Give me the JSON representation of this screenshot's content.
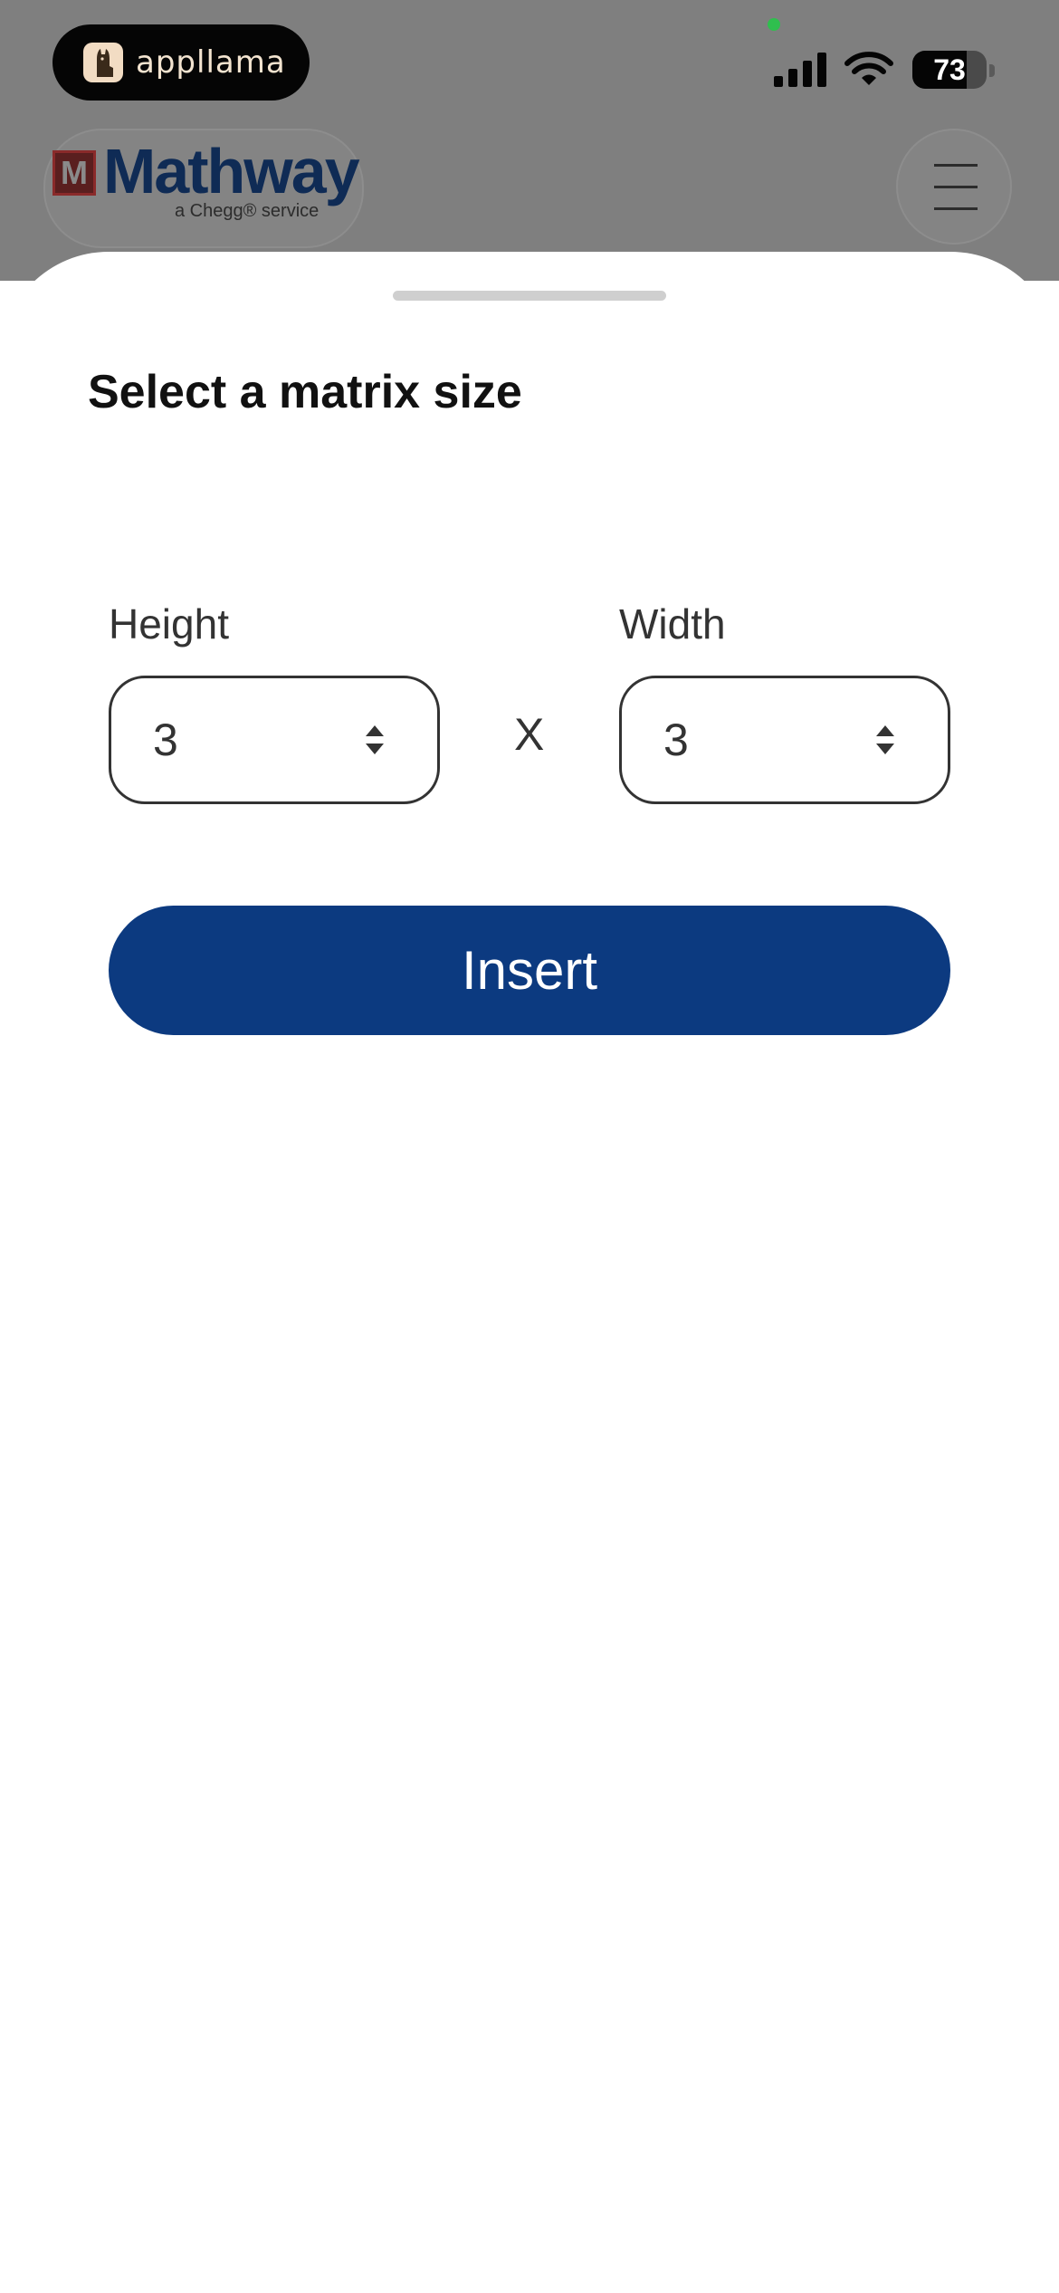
{
  "status_bar": {
    "app_name": "appllama",
    "battery_level": "73",
    "battery_fill_percent": 73,
    "camera_indicator_color": "#2fbf4e"
  },
  "header": {
    "logo_text": "Mathway",
    "logo_subtitle": "a Chegg® service",
    "menu_icon": "hamburger-menu-icon"
  },
  "sheet": {
    "title": "Select a matrix size",
    "height_label": "Height",
    "height_value": "3",
    "times_symbol": "X",
    "width_label": "Width",
    "width_value": "3",
    "insert_label": "Insert"
  },
  "colors": {
    "accent": "#0c3a80",
    "overlay": "#7f7f7f",
    "text": "#333333"
  }
}
